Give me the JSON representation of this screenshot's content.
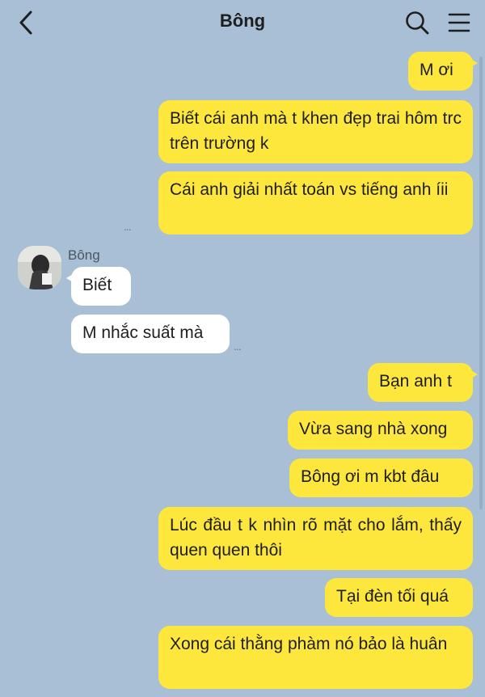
{
  "header": {
    "title": "Bông",
    "back_icon": "chevron-left-icon",
    "search_icon": "search-icon",
    "menu_icon": "hamburger-menu-icon"
  },
  "colors": {
    "background": "#a9bfd6",
    "my_bubble": "#fde73c",
    "their_bubble": "#ffffff"
  },
  "contact": {
    "name": "Bông"
  },
  "messages": [
    {
      "from": "me",
      "text": "M ơi"
    },
    {
      "from": "me",
      "text": "Biết cái anh mà t khen đẹp trai hôm trc trên trường k"
    },
    {
      "from": "me",
      "text": "Cái anh giải nhất toán vs tiếng anh íii"
    },
    {
      "from": "them",
      "text": "Biết"
    },
    {
      "from": "them",
      "text": "M nhắc suất mà"
    },
    {
      "from": "me",
      "text": "Bạn anh t"
    },
    {
      "from": "me",
      "text": "Vừa sang nhà xong"
    },
    {
      "from": "me",
      "text": "Bông ơi m kbt đâu"
    },
    {
      "from": "me",
      "text": "Lúc đầu t k nhìn rõ mặt cho lắm, thấy quen quen thôi"
    },
    {
      "from": "me",
      "text": "Tại đèn tối quá"
    },
    {
      "from": "me",
      "text": "Xong cái thằng phàm nó bảo là huân"
    }
  ],
  "read_indicator": "..."
}
